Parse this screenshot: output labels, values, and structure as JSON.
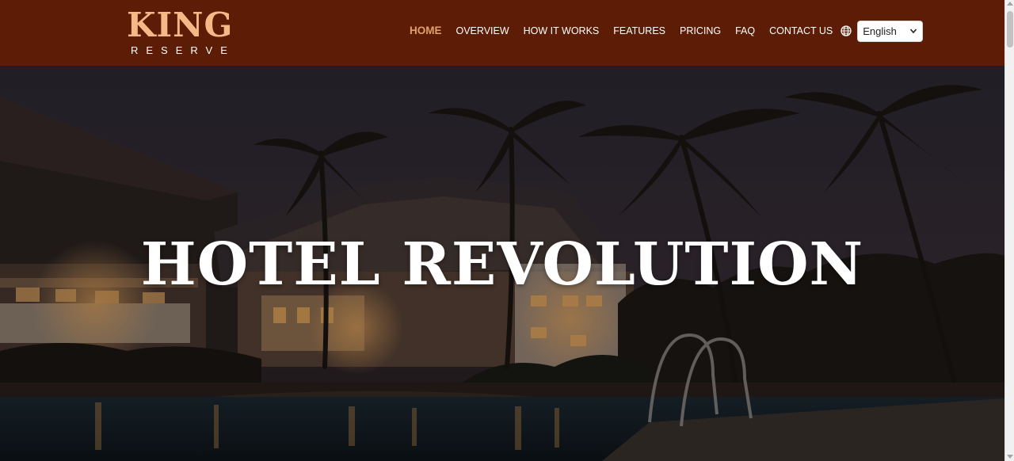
{
  "brand": {
    "name": "KING",
    "tagline": "RESERVE",
    "colors": {
      "header_bg": "#5c1c06",
      "logo_accent": "#f4b987",
      "active_link": "#e0a06a"
    }
  },
  "nav": {
    "items": [
      {
        "label": "HOME",
        "active": true
      },
      {
        "label": "OVERVIEW",
        "active": false
      },
      {
        "label": "HOW IT WORKS",
        "active": false
      },
      {
        "label": "FEATURES",
        "active": false
      },
      {
        "label": "PRICING",
        "active": false
      },
      {
        "label": "FAQ",
        "active": false
      },
      {
        "label": "CONTACT US",
        "active": false
      }
    ],
    "language_icon": "globe-icon",
    "language": {
      "selected": "English"
    }
  },
  "hero": {
    "title": "HOTEL REVOLUTION",
    "background": "night-resort-pool-with-palm-trees"
  }
}
